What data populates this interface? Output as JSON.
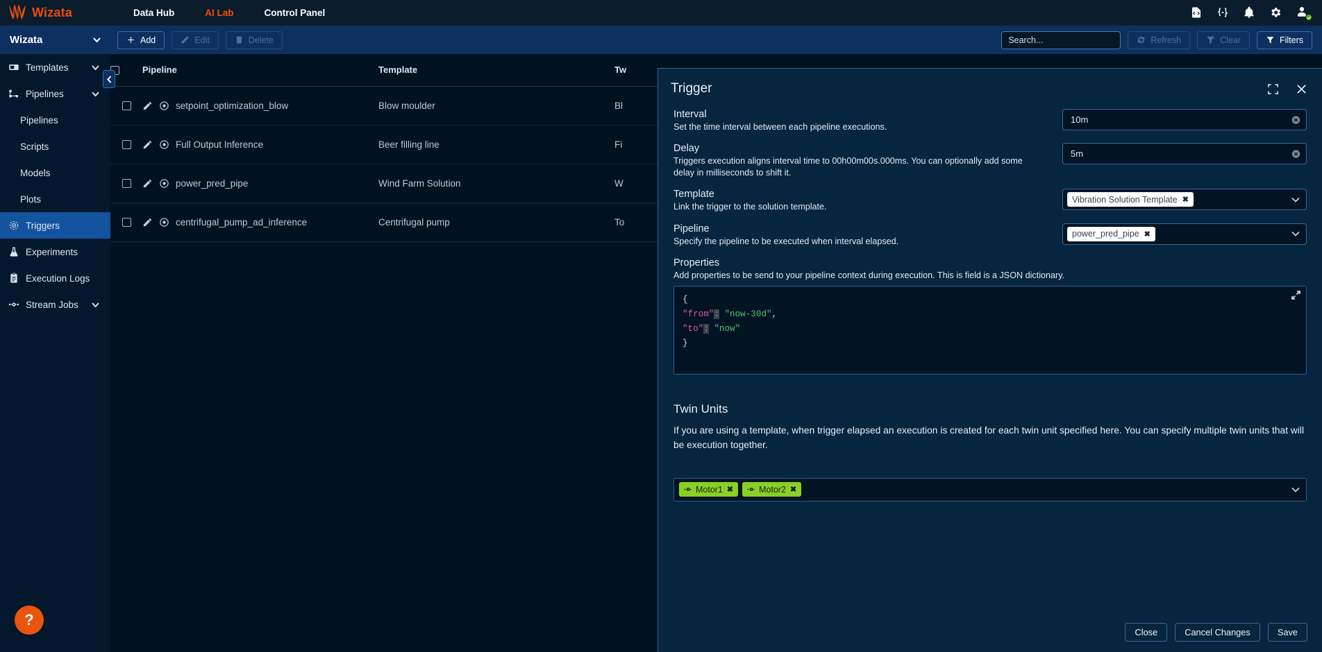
{
  "topnav": {
    "brand": "Wizata",
    "brand_icon": "wizata-flame-logo",
    "items": [
      {
        "label": "Data Hub",
        "active": false
      },
      {
        "label": "AI Lab",
        "active": true
      },
      {
        "label": "Control Panel",
        "active": false
      }
    ],
    "right_icons": [
      {
        "name": "code-file-icon"
      },
      {
        "name": "json-braces-icon"
      },
      {
        "name": "bell-icon"
      },
      {
        "name": "gear-icon"
      },
      {
        "name": "user-avatar-icon"
      }
    ],
    "accent_color": "#f0500a"
  },
  "toolbar": {
    "workspace": "Wizata",
    "add_label": "Add",
    "edit_label": "Edit",
    "delete_label": "Delete",
    "refresh_label": "Refresh",
    "clear_label": "Clear",
    "filters_label": "Filters",
    "search_placeholder": "Search...",
    "search_value": ""
  },
  "sidebar": {
    "items": [
      {
        "label": "Templates",
        "icon": "templates-icon",
        "type": "group",
        "selected": false
      },
      {
        "label": "Pipelines",
        "icon": "pipelines-icon",
        "type": "group",
        "selected": false
      },
      {
        "label": "Pipelines",
        "icon": "",
        "type": "sub",
        "selected": false
      },
      {
        "label": "Scripts",
        "icon": "",
        "type": "sub",
        "selected": false
      },
      {
        "label": "Models",
        "icon": "",
        "type": "sub",
        "selected": false
      },
      {
        "label": "Plots",
        "icon": "",
        "type": "sub",
        "selected": false
      },
      {
        "label": "Triggers",
        "icon": "triggers-icon",
        "type": "item",
        "selected": true
      },
      {
        "label": "Experiments",
        "icon": "experiments-flask-icon",
        "type": "item",
        "selected": false
      },
      {
        "label": "Execution Logs",
        "icon": "execution-logs-icon",
        "type": "item",
        "selected": false
      },
      {
        "label": "Stream Jobs",
        "icon": "stream-jobs-icon",
        "type": "group",
        "selected": false
      }
    ],
    "collapse_icon": "chevron-left-icon",
    "help_label": "?"
  },
  "table": {
    "columns": [
      "Pipeline",
      "Template",
      "Tw"
    ],
    "rows": [
      {
        "pipeline": "setpoint_optimization_blow",
        "template": "Blow moulder",
        "twin": "Bl"
      },
      {
        "pipeline": "Full Output Inference",
        "template": "Beer filling line",
        "twin": "Fi"
      },
      {
        "pipeline": "power_pred_pipe",
        "template": "Wind Farm Solution",
        "twin": "W"
      },
      {
        "pipeline": "centrifugal_pump_ad_inference",
        "template": "Centrifugal pump",
        "twin": "To"
      }
    ]
  },
  "panel": {
    "title": "Trigger",
    "expand_icon": "expand-fullscreen-icon",
    "close_icon": "close-icon",
    "fields": [
      {
        "title": "Interval",
        "desc": "Set the time interval between each pipeline executions.",
        "value": "10m",
        "kind": "text"
      },
      {
        "title": "Delay",
        "desc": "Triggers execution aligns interval time to 00h00m00s.000ms. You can optionally add some delay in milliseconds to shift it.",
        "value": "5m",
        "kind": "text"
      },
      {
        "title": "Template",
        "desc": "Link the trigger to the solution template.",
        "chips": [
          "Vibration Solution Template"
        ],
        "kind": "select"
      },
      {
        "title": "Pipeline",
        "desc": "Specify the pipeline to be executed when interval elapsed.",
        "chips": [
          "power_pred_pipe"
        ],
        "kind": "select"
      }
    ],
    "properties": {
      "title": "Properties",
      "desc": "Add properties to be send to your pipeline context during execution. This is field is a JSON dictionary.",
      "code_lines": [
        {
          "indent": 0,
          "parts": [
            {
              "t": "{",
              "c": "p"
            }
          ]
        },
        {
          "indent": 1,
          "parts": [
            {
              "t": "\"from\"",
              "c": "k"
            },
            {
              "t": ":",
              "c": "colon"
            },
            {
              "t": " \"now-30d\"",
              "c": "s"
            },
            {
              "t": ",",
              "c": "p"
            }
          ]
        },
        {
          "indent": 1,
          "parts": [
            {
              "t": "\"to\"",
              "c": "k"
            },
            {
              "t": ":",
              "c": "colon"
            },
            {
              "t": " \"now\"",
              "c": "s"
            }
          ]
        },
        {
          "indent": 0,
          "parts": [
            {
              "t": "}",
              "c": "p"
            }
          ]
        }
      ],
      "expand_icon": "expand-code-icon"
    },
    "twin_units": {
      "title": "Twin Units",
      "desc": "If you are using a template, when trigger elapsed an execution is created for each twin unit specified here. You can specify multiple twin units that will be execution together.",
      "chips": [
        "Motor1",
        "Motor2"
      ],
      "chip_color": "#8bcf26",
      "chip_icon": "twin-unit-icon"
    },
    "footer": {
      "close_label": "Close",
      "cancel_label": "Cancel Changes",
      "save_label": "Save"
    }
  }
}
